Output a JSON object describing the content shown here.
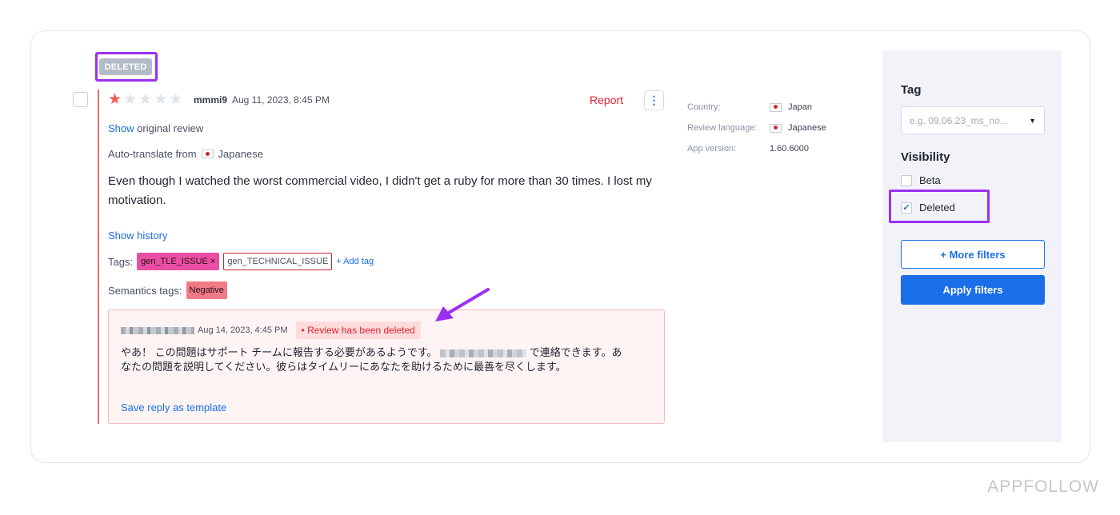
{
  "review": {
    "status_badge": "DELETED",
    "rating": 1,
    "max_rating": 5,
    "author": "mmmi9",
    "date": "Aug 11, 2023, 8:45 PM",
    "report_label": "Report",
    "more_icon": "⋮",
    "show_link": "Show",
    "show_suffix": " original review",
    "auto_translate": "Auto-translate from",
    "source_language": "Japanese",
    "body": "Even though I watched the worst commercial video, I didn't get a ruby for more than 30 times. I lost my motivation.",
    "show_history": "Show history",
    "tags_label": "Tags:",
    "tags": [
      {
        "label": "gen_TLE_ISSUE ×"
      },
      {
        "label": "gen_TECHNICAL_ISSUE"
      }
    ],
    "add_tag": "+ Add tag",
    "semantics_label": "Semantics tags:",
    "semantic_tags": [
      "Negative"
    ]
  },
  "reply": {
    "date": "Aug 14, 2023, 4:45 PM",
    "deleted_notice": "• Review has been deleted",
    "text_part1": "やあ！ この問題はサポート チームに報告する必要があるようです。",
    "text_part2": "で連絡できます。あなたの問題を説明してください。彼らはタイムリーにあなたを助けるために最善を尽くします。",
    "save_template": "Save reply as template"
  },
  "meta": {
    "country_label": "Country:",
    "country_value": "Japan",
    "review_language_label": "Review language:",
    "review_language_value": "Japanese",
    "app_version_label": "App version:",
    "app_version_value": "1.60.6000"
  },
  "filters": {
    "tag_heading": "Tag",
    "tag_placeholder": "e.g. 09.06.23_ms_no...",
    "visibility_heading": "Visibility",
    "options": [
      {
        "label": "Beta",
        "checked": false
      },
      {
        "label": "Deleted",
        "checked": true
      }
    ],
    "more_filters": "+ More filters",
    "apply_filters": "Apply filters"
  },
  "watermark": "APPFOLLOW",
  "colors": {
    "accent_blue": "#1a6fe8",
    "annotation_purple": "#9b30f2",
    "deleted_red": "#e0202e",
    "tag_pink": "#ea4ea2"
  },
  "icons": {
    "star": "★",
    "check": "✓",
    "caret": "▼"
  }
}
